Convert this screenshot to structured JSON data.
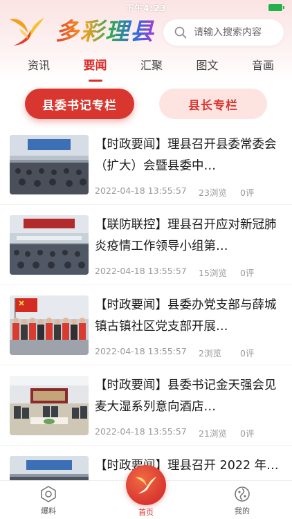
{
  "status_bar": {
    "time": "下午4:23"
  },
  "header": {
    "app_title": "多彩理县",
    "search_placeholder": "请输入搜索内容"
  },
  "tabs": [
    {
      "label": "资讯",
      "active": false
    },
    {
      "label": "要闻",
      "active": true
    },
    {
      "label": "汇聚",
      "active": false
    },
    {
      "label": "图文",
      "active": false
    },
    {
      "label": "音画",
      "active": false
    }
  ],
  "columns": {
    "primary_label": "县委书记专栏",
    "secondary_label": "县长专栏"
  },
  "news": [
    {
      "title": "【时政要闻】理县召开县委常委会（扩大）会暨县委中…",
      "date": "2022-04-18 13:55:57",
      "views": "23浏览",
      "comments": "0评",
      "thumb": "meeting-hall"
    },
    {
      "title": "【联防联控】理县召开应对新冠肺炎疫情工作领导小组第…",
      "date": "2022-04-18 13:55:57",
      "views": "15浏览",
      "comments": "0评",
      "thumb": "meeting-hall"
    },
    {
      "title": "【时政要闻】县委办党支部与薛城镇古镇社区党支部开展…",
      "date": "2022-04-18 13:55:57",
      "views": "2浏览",
      "comments": "0评",
      "thumb": "group-flag"
    },
    {
      "title": "【时政要闻】县委书记金天强会见麦大湿系列意向酒店…",
      "date": "2022-04-18 13:55:57",
      "views": "21浏览",
      "comments": "0评",
      "thumb": "reception-room"
    },
    {
      "title": "【时政要闻】理县召开 2022 年…",
      "date": "",
      "views": "",
      "comments": "",
      "thumb": "meeting-hall"
    }
  ],
  "bottom_nav": {
    "left_label": "爆料",
    "center_label": "首页",
    "right_label": "我的"
  },
  "colors": {
    "accent": "#d9362f",
    "accent_light": "#fde4e1"
  }
}
